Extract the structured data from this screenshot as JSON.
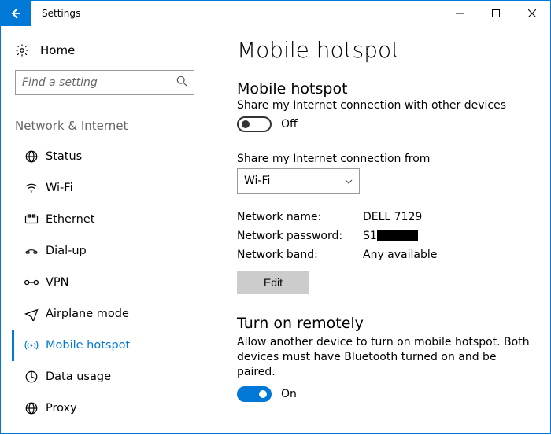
{
  "window": {
    "title": "Settings"
  },
  "sidebar": {
    "home_label": "Home",
    "search_placeholder": "Find a setting",
    "group_label": "Network & Internet",
    "items": [
      {
        "icon": "status",
        "label": "Status"
      },
      {
        "icon": "wifi",
        "label": "Wi-Fi"
      },
      {
        "icon": "ethernet",
        "label": "Ethernet"
      },
      {
        "icon": "dialup",
        "label": "Dial-up"
      },
      {
        "icon": "vpn",
        "label": "VPN"
      },
      {
        "icon": "airplane",
        "label": "Airplane mode"
      },
      {
        "icon": "hotspot",
        "label": "Mobile hotspot",
        "active": true
      },
      {
        "icon": "data",
        "label": "Data usage"
      },
      {
        "icon": "proxy",
        "label": "Proxy"
      }
    ]
  },
  "main": {
    "title": "Mobile hotspot",
    "hotspot": {
      "heading": "Mobile hotspot",
      "description": "Share my Internet connection with other devices",
      "toggle_state": "off",
      "toggle_label": "Off"
    },
    "share_from": {
      "label": "Share my Internet connection from",
      "value": "Wi-Fi"
    },
    "network": {
      "name_label": "Network name:",
      "name_value": "DELL 7129",
      "password_label": "Network password:",
      "password_prefix": "S1",
      "band_label": "Network band:",
      "band_value": "Any available",
      "edit_label": "Edit"
    },
    "remote": {
      "heading": "Turn on remotely",
      "description": "Allow another device to turn on mobile hotspot. Both devices must have Bluetooth turned on and be paired.",
      "toggle_state": "on",
      "toggle_label": "On"
    }
  }
}
